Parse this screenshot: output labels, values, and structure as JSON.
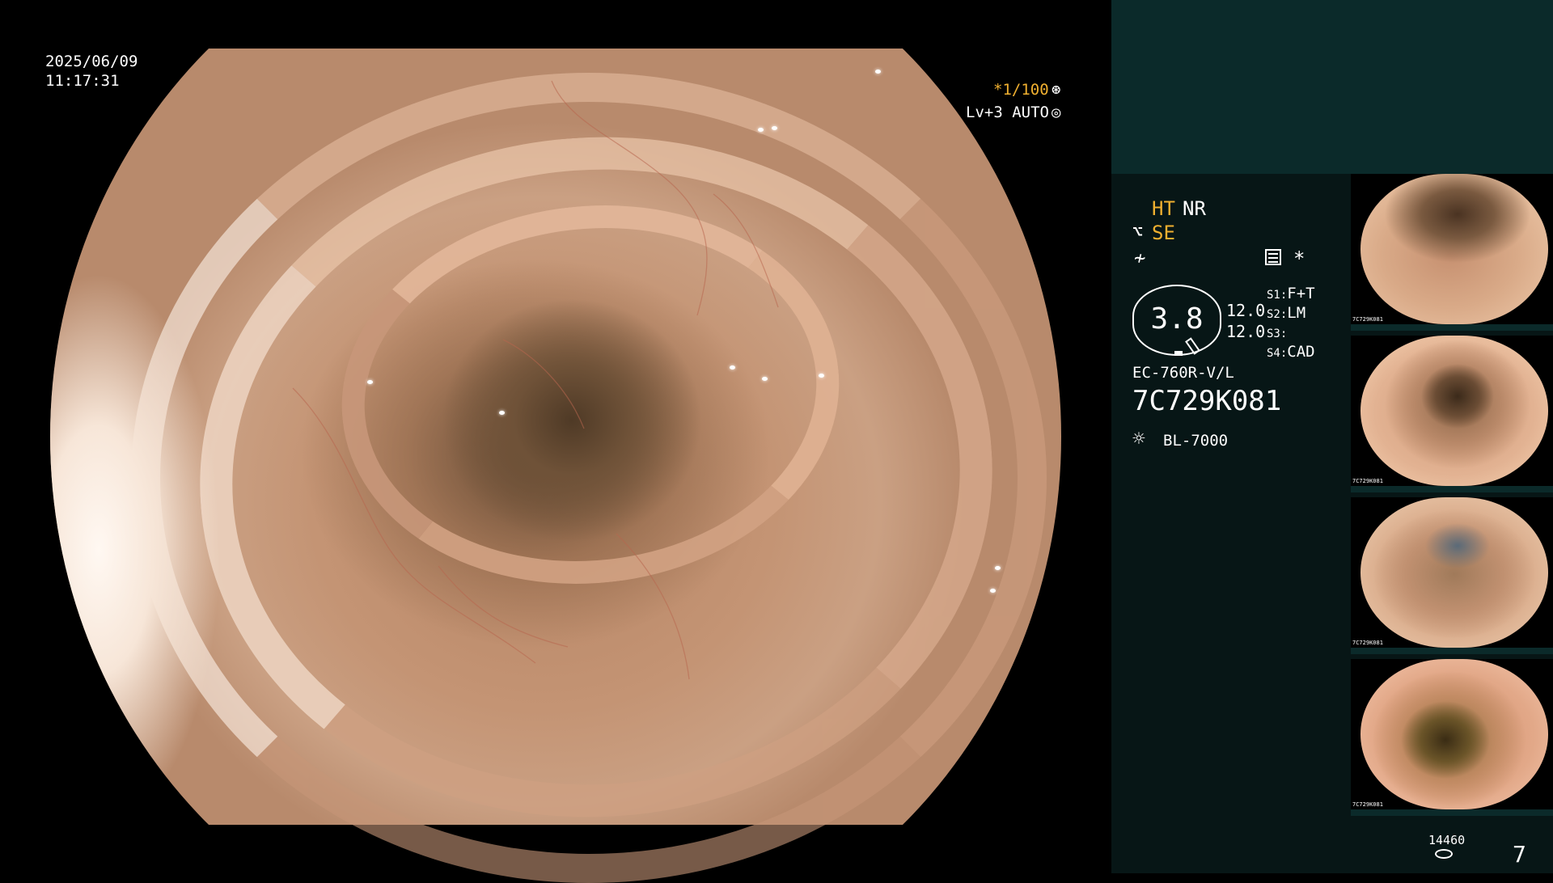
{
  "overlay": {
    "date": "2025/06/09",
    "time": "11:17:31",
    "shutter": "*1/100",
    "shutter_icon": "aperture-icon",
    "iris": "Lv+3 AUTO",
    "iris_icon": "auto-iris-icon"
  },
  "panel": {
    "ht": "HT",
    "nr": "NR",
    "se": "SE",
    "gauge_value": "3.8",
    "value_1": "12.0",
    "value_2": "12.0",
    "switches": [
      {
        "label": "S1:",
        "value": "F+T"
      },
      {
        "label": "S2:",
        "value": "LM"
      },
      {
        "label": "S3:",
        "value": ""
      },
      {
        "label": "S4:",
        "value": "CAD"
      }
    ],
    "scope_model": "EC-760R-V/L",
    "scope_serial": "7C729K081",
    "light_source": "BL-7000",
    "star": "*"
  },
  "thumbnails": [
    {
      "caption": "7C729K081"
    },
    {
      "caption": "7C729K081"
    },
    {
      "caption": "7C729K081"
    },
    {
      "caption": "7C729K081"
    }
  ],
  "footer": {
    "count": "14460",
    "page": "7"
  },
  "colors": {
    "accent": "#f0b030",
    "panel_top": "#0b2a2a",
    "panel": "#071616"
  }
}
